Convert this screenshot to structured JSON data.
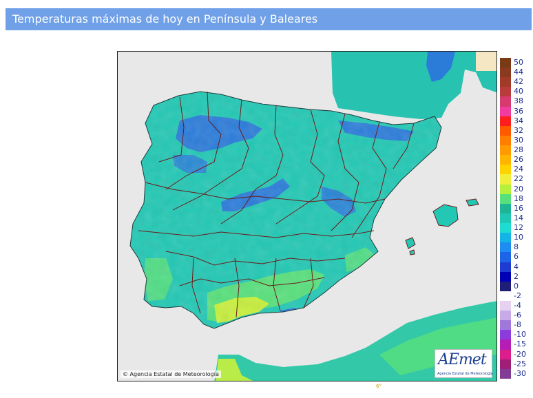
{
  "header": {
    "title": "Temperaturas máximas de hoy en Península y Baleares"
  },
  "map": {
    "credit": "Agencia Estatal de Meteorología",
    "logo_text": "AEmet",
    "logo_subtext": "Agencia Estatal de Meteorología",
    "footnote": "6°",
    "colors": {
      "sea": "#e8e8e8",
      "france": "#27c2b0",
      "africa": "#32c8a8",
      "land_base": "#22c8b4",
      "cold": "#2d6fe0",
      "warm": "#58e07c",
      "hot": "#c8f03c",
      "borders": "#6b1a1a",
      "coast": "#1f3a3a"
    }
  },
  "legend": {
    "items": [
      {
        "label": "50",
        "color": "#7a3a16"
      },
      {
        "label": "44",
        "color": "#8a3a1f"
      },
      {
        "label": "42",
        "color": "#a23a28"
      },
      {
        "label": "40",
        "color": "#b83c3c"
      },
      {
        "label": "38",
        "color": "#d63a6e"
      },
      {
        "label": "36",
        "color": "#f03c9e"
      },
      {
        "label": "34",
        "color": "#ff1e1e"
      },
      {
        "label": "32",
        "color": "#ff5a00"
      },
      {
        "label": "30",
        "color": "#ff7d00"
      },
      {
        "label": "28",
        "color": "#ff9a00"
      },
      {
        "label": "26",
        "color": "#ffb400"
      },
      {
        "label": "24",
        "color": "#ffd200"
      },
      {
        "label": "22",
        "color": "#f0f03c"
      },
      {
        "label": "20",
        "color": "#b4f03c"
      },
      {
        "label": "18",
        "color": "#58e07c"
      },
      {
        "label": "16",
        "color": "#1eb496"
      },
      {
        "label": "14",
        "color": "#1ec8b4"
      },
      {
        "label": "12",
        "color": "#1edcd2"
      },
      {
        "label": "10",
        "color": "#14b4e6"
      },
      {
        "label": "8",
        "color": "#1e8cf0"
      },
      {
        "label": "6",
        "color": "#1e64e6"
      },
      {
        "label": "4",
        "color": "#1e3cd2"
      },
      {
        "label": "2",
        "color": "#0000b4"
      },
      {
        "label": "0",
        "color": "#1e1e78"
      },
      {
        "label": "-2",
        "color": "#ffffff"
      },
      {
        "label": "-4",
        "color": "#e6d2f0"
      },
      {
        "label": "-6",
        "color": "#c8aae6"
      },
      {
        "label": "-8",
        "color": "#a078dc"
      },
      {
        "label": "-10",
        "color": "#8c3cdc"
      },
      {
        "label": "-15",
        "color": "#b41eb4"
      },
      {
        "label": "-20",
        "color": "#dc1e8c"
      },
      {
        "label": "-25",
        "color": "#a01e78"
      },
      {
        "label": "-30",
        "color": "#823c96"
      }
    ]
  }
}
